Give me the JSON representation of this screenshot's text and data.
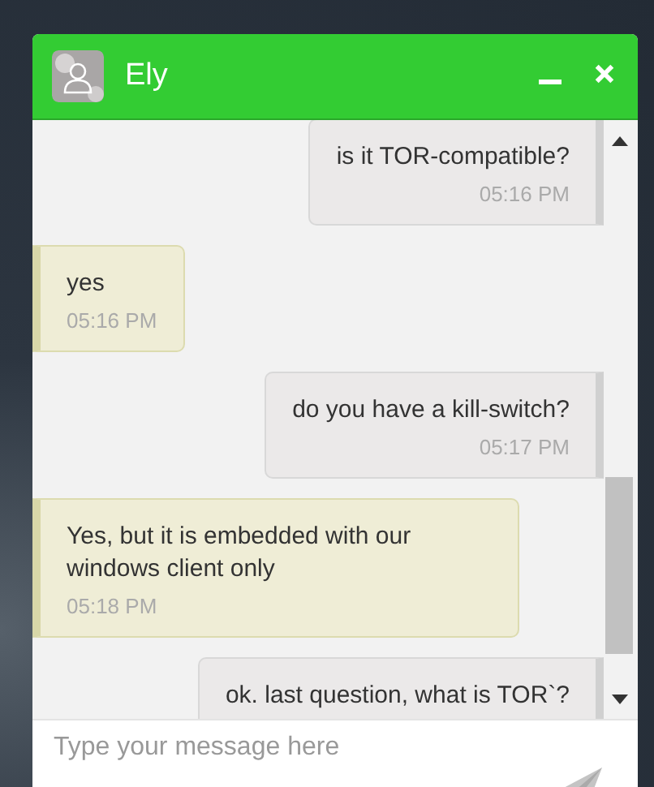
{
  "header": {
    "contact": "Ely"
  },
  "messages": [
    {
      "kind": "sent",
      "text": "is it TOR-compatible?",
      "time": "05:16 PM"
    },
    {
      "kind": "received",
      "text": "yes",
      "time": "05:16 PM"
    },
    {
      "kind": "sent",
      "text": "do you have a kill-switch?",
      "time": "05:17 PM"
    },
    {
      "kind": "received",
      "text": "Yes, but it is embedded with our windows client only",
      "time": "05:18 PM"
    },
    {
      "kind": "sent",
      "text": "ok. last question, what is TOR`?"
    }
  ],
  "composer": {
    "placeholder": "Type your message here"
  }
}
